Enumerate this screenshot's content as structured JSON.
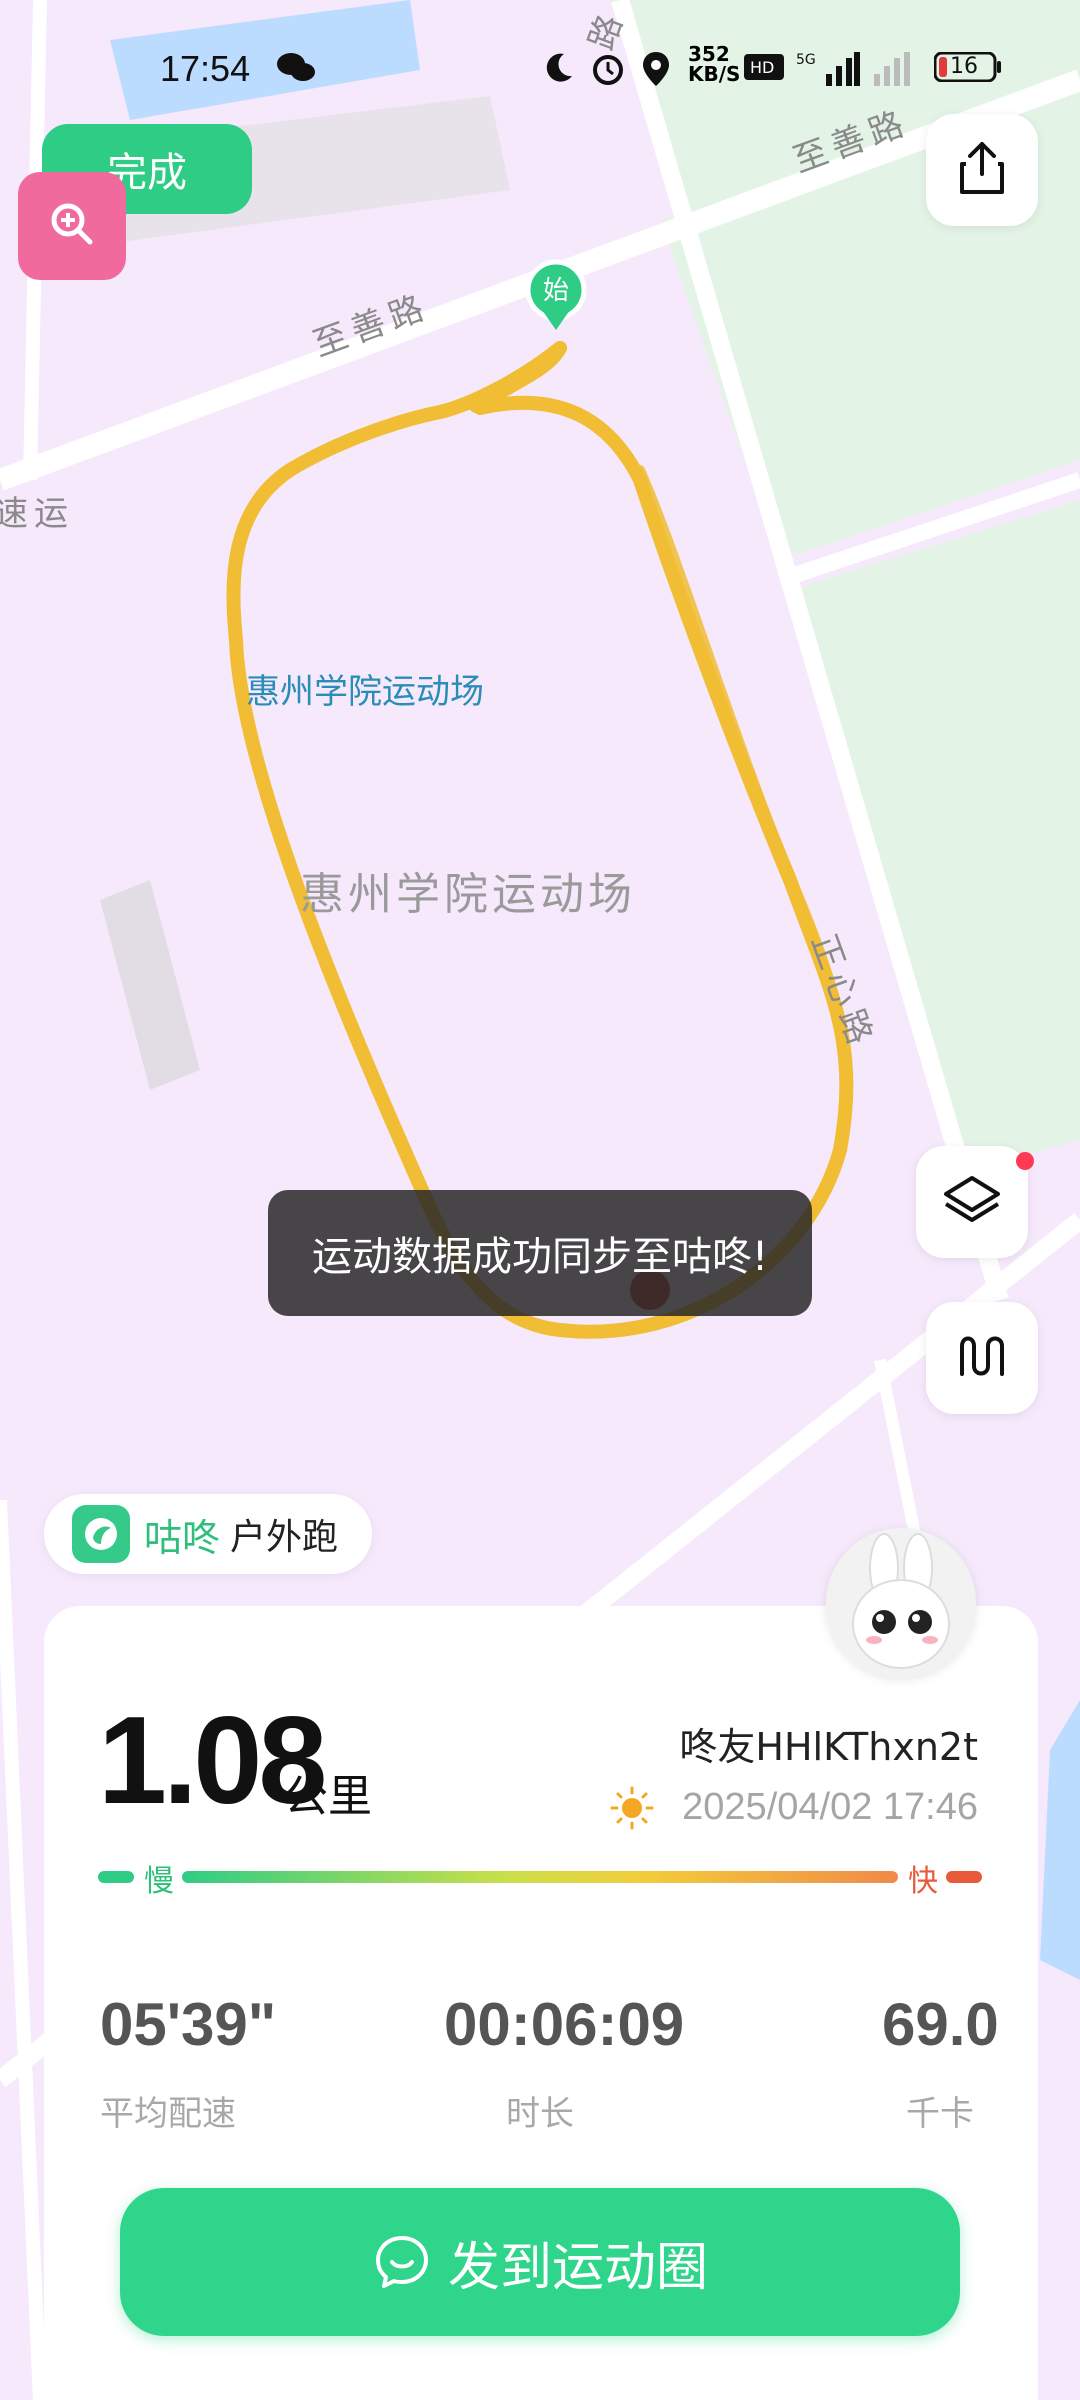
{
  "status_bar": {
    "time": "17:54",
    "network_speed": "352 KB/S",
    "battery": "16"
  },
  "map": {
    "road_labels": [
      "路",
      "至善路",
      "至善路",
      "速运",
      "正心路"
    ],
    "poi_label_blue": "惠州学院运动场",
    "poi_label_gray": "惠州学院运动场",
    "start_marker": "始",
    "route_color": "#f0bd34"
  },
  "buttons": {
    "done": "完成",
    "zoom_icon": "zoom-in-icon",
    "share_icon": "share-icon",
    "layers_icon": "layers-icon",
    "route_icon": "route-icon"
  },
  "toast": "运动数据成功同步至咕咚!",
  "brand": {
    "name": "咕咚",
    "activity": "户外跑"
  },
  "summary": {
    "distance": "1.08",
    "distance_unit": "公里",
    "username": "咚友HHlKThxn2t",
    "datetime": "2025/04/02 17:46",
    "pace_slow": "慢",
    "pace_fast": "快"
  },
  "stats": [
    {
      "value": "05'39\"",
      "label": "平均配速"
    },
    {
      "value": "00:06:09",
      "label": "时长"
    },
    {
      "value": "69.0",
      "label": "千卡"
    }
  ],
  "post_button": "发到运动圈",
  "colors": {
    "accent": "#2ed58a",
    "map_bg": "#f6e9fb",
    "green_area": "#e5f5e7"
  }
}
